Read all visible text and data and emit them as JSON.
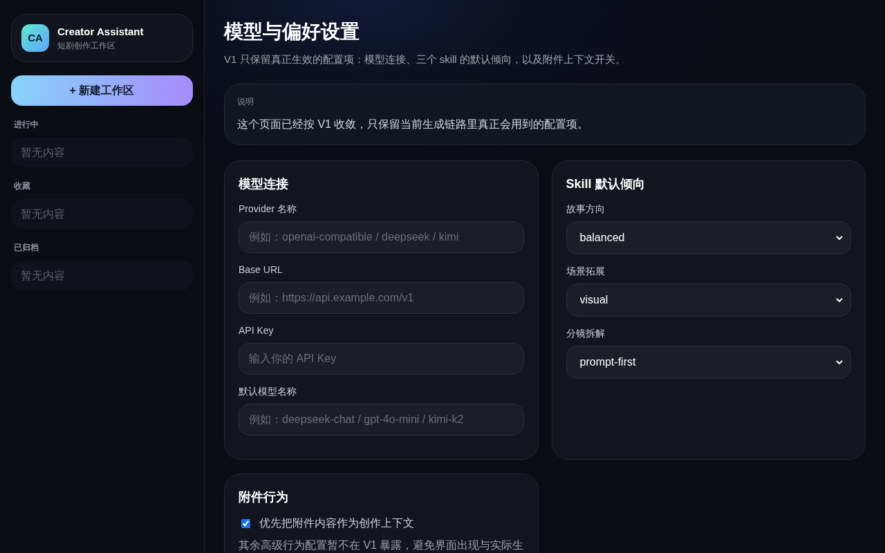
{
  "sidebar": {
    "brand": {
      "logo": "CA",
      "name": "Creator Assistant",
      "subtitle": "短剧创作工作区"
    },
    "new_button": "+ 新建工作区",
    "sections": [
      {
        "title": "进行中",
        "empty": "暂无内容"
      },
      {
        "title": "收藏",
        "empty": "暂无内容"
      },
      {
        "title": "已归档",
        "empty": "暂无内容"
      }
    ]
  },
  "page": {
    "title": "模型与偏好设置",
    "subtitle": "V1 只保留真正生效的配置项：模型连接、三个 skill 的默认倾向，以及附件上下文开关。"
  },
  "note": {
    "label": "说明",
    "text": "这个页面已经按 V1 收敛，只保留当前生成链路里真正会用到的配置项。"
  },
  "cards": [
    {
      "kind": "inputs",
      "title": "模型连接",
      "fields": [
        {
          "label": "Provider 名称",
          "placeholder": "例如：openai-compatible / deepseek / kimi"
        },
        {
          "label": "Base URL",
          "placeholder": "例如：https://api.example.com/v1"
        },
        {
          "label": "API Key",
          "placeholder": "输入你的 API Key"
        },
        {
          "label": "默认模型名称",
          "placeholder": "例如：deepseek-chat / gpt-4o-mini / kimi-k2"
        }
      ]
    },
    {
      "kind": "selects",
      "title": "Skill 默认倾向",
      "fields": [
        {
          "label": "故事方向",
          "value": "balanced"
        },
        {
          "label": "场景拓展",
          "value": "visual"
        },
        {
          "label": "分镜拆解",
          "value": "prompt-first"
        }
      ]
    },
    {
      "kind": "checkbox",
      "title": "附件行为",
      "checkbox": {
        "label": "优先把附件内容作为创作上下文",
        "checked": true
      },
      "text": "其余高级行为配置暂不在 V1 暴露，避免界面出现与实际生"
    }
  ]
}
